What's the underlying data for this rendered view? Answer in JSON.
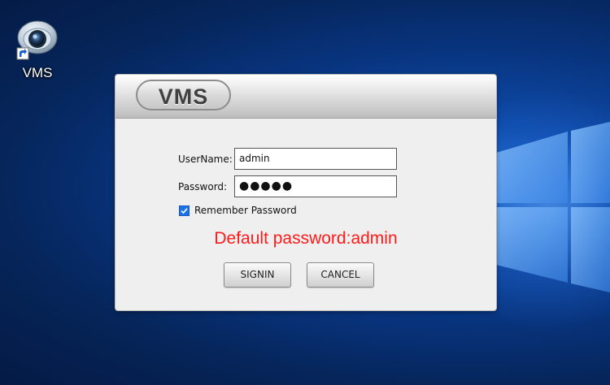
{
  "desktop": {
    "icon": {
      "name": "vms-camera-icon",
      "label": "VMS"
    }
  },
  "dialog": {
    "logo_text": "VMS",
    "username_label": "UserName:",
    "username_value": "admin",
    "password_label": "Password:",
    "password_value": "●●●●●",
    "remember_label": "Remember Password",
    "remember_checked": true,
    "notice_text": "Default password:admin",
    "signin_label": "SIGNIN",
    "cancel_label": "CANCEL"
  },
  "colors": {
    "notice": "#ff1a1a",
    "checkbox": "#1a73e8",
    "desktop_bg": "#08347e"
  }
}
